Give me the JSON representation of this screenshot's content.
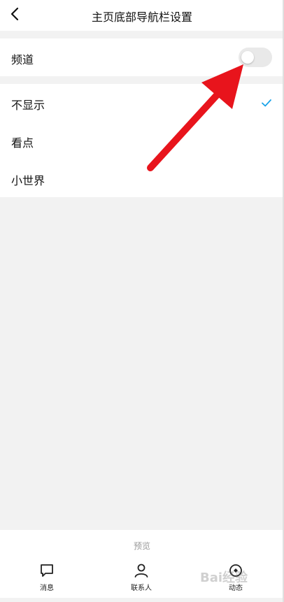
{
  "header": {
    "back_icon": "chevron-left-icon",
    "title": "主页底部导航栏设置"
  },
  "channel": {
    "label": "频道",
    "toggle_state": "off"
  },
  "options": [
    {
      "label": "不显示",
      "selected": true
    },
    {
      "label": "看点",
      "selected": false
    },
    {
      "label": "小世界",
      "selected": false
    }
  ],
  "bottom": {
    "preview_label": "预览",
    "tabs": [
      {
        "label": "消息",
        "icon": "chat-bubble-icon"
      },
      {
        "label": "联系人",
        "icon": "person-icon"
      },
      {
        "label": "动态",
        "icon": "star-burst-icon"
      }
    ]
  },
  "colors": {
    "accent_check": "#1aa3e8",
    "arrow": "#e8141c"
  }
}
